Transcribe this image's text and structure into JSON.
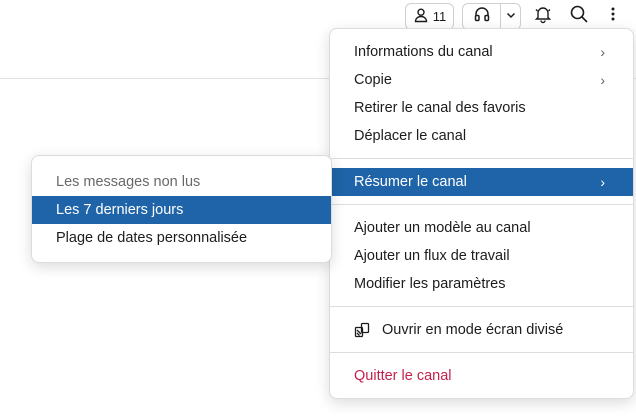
{
  "toolbar": {
    "member_count": "11",
    "icons": [
      "person-icon",
      "headphones-icon",
      "chevron-down-icon",
      "bell-off-icon",
      "search-icon",
      "more-vertical-icon"
    ]
  },
  "menu": {
    "items": [
      {
        "label": "Informations du canal",
        "has_submenu": true
      },
      {
        "label": "Copie",
        "has_submenu": true
      },
      {
        "label": "Retirer le canal des favoris"
      },
      {
        "label": "Déplacer le canal"
      },
      {
        "label": "Résumer le canal",
        "has_submenu": true,
        "active": true
      },
      {
        "label": "Ajouter un modèle au canal"
      },
      {
        "label": "Ajouter un flux de travail"
      },
      {
        "label": "Modifier les paramètres"
      },
      {
        "label": "Ouvrir en mode écran divisé",
        "icon": "split-screen-icon"
      },
      {
        "label": "Quitter le canal",
        "danger": true
      }
    ],
    "chevron": "›"
  },
  "submenu": {
    "items": [
      {
        "label": "Les messages non lus",
        "muted": true
      },
      {
        "label": "Les 7 derniers jours",
        "active": true
      },
      {
        "label": "Plage de dates personnalisée"
      }
    ]
  },
  "colors": {
    "accent": "#1f64a8",
    "danger": "#c4204e",
    "text": "#1d1c1d",
    "muted": "#696969"
  }
}
